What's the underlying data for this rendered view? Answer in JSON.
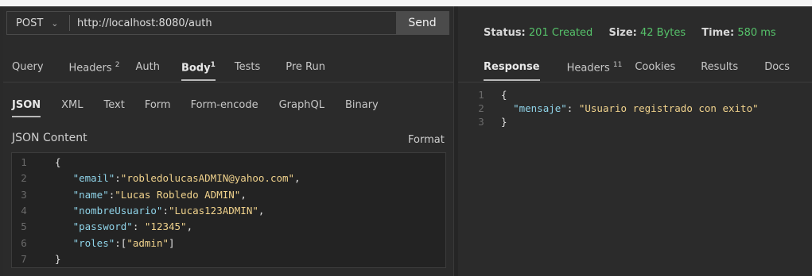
{
  "request": {
    "method": "POST",
    "url": "http://localhost:8080/auth",
    "send_label": "Send",
    "tabs": [
      {
        "label": "Query",
        "badge": ""
      },
      {
        "label": "Headers",
        "badge": "2"
      },
      {
        "label": "Auth",
        "badge": ""
      },
      {
        "label": "Body",
        "badge": "1"
      },
      {
        "label": "Tests",
        "badge": ""
      },
      {
        "label": "Pre Run",
        "badge": ""
      }
    ],
    "body_types": [
      "JSON",
      "XML",
      "Text",
      "Form",
      "Form-encode",
      "GraphQL",
      "Binary"
    ],
    "json_content_label": "JSON Content",
    "format_label": "Format",
    "lines": [
      {
        "n": "1",
        "indent": "",
        "tokens": [
          {
            "t": "p",
            "v": "{"
          }
        ]
      },
      {
        "n": "2",
        "indent": "   ",
        "tokens": [
          {
            "t": "k",
            "v": "\"email\""
          },
          {
            "t": "p",
            "v": ":"
          },
          {
            "t": "s",
            "v": "\"robledolucasADMIN@yahoo.com\""
          },
          {
            "t": "p",
            "v": ","
          }
        ]
      },
      {
        "n": "3",
        "indent": "   ",
        "tokens": [
          {
            "t": "k",
            "v": "\"name\""
          },
          {
            "t": "p",
            "v": ":"
          },
          {
            "t": "s",
            "v": "\"Lucas Robledo ADMIN\""
          },
          {
            "t": "p",
            "v": ","
          }
        ]
      },
      {
        "n": "4",
        "indent": "   ",
        "tokens": [
          {
            "t": "k",
            "v": "\"nombreUsuario\""
          },
          {
            "t": "p",
            "v": ":"
          },
          {
            "t": "s",
            "v": "\"Lucas123ADMIN\""
          },
          {
            "t": "p",
            "v": ","
          }
        ]
      },
      {
        "n": "5",
        "indent": "   ",
        "tokens": [
          {
            "t": "k",
            "v": "\"password\""
          },
          {
            "t": "p",
            "v": ": "
          },
          {
            "t": "s",
            "v": "\"12345\""
          },
          {
            "t": "p",
            "v": ","
          }
        ]
      },
      {
        "n": "6",
        "indent": "   ",
        "tokens": [
          {
            "t": "k",
            "v": "\"roles\""
          },
          {
            "t": "p",
            "v": ":["
          },
          {
            "t": "s",
            "v": "\"admin\""
          },
          {
            "t": "p",
            "v": "]"
          }
        ]
      },
      {
        "n": "7",
        "indent": "",
        "tokens": [
          {
            "t": "p",
            "v": "}"
          }
        ]
      }
    ]
  },
  "response": {
    "status_label": "Status:",
    "status_value": "201 Created",
    "size_label": "Size:",
    "size_value": "42 Bytes",
    "time_label": "Time:",
    "time_value": "580 ms",
    "tabs": [
      {
        "label": "Response",
        "badge": ""
      },
      {
        "label": "Headers",
        "badge": "11"
      },
      {
        "label": "Cookies",
        "badge": ""
      },
      {
        "label": "Results",
        "badge": ""
      },
      {
        "label": "Docs",
        "badge": ""
      }
    ],
    "lines": [
      {
        "n": "1",
        "indent": "",
        "tokens": [
          {
            "t": "p",
            "v": "{"
          }
        ]
      },
      {
        "n": "2",
        "indent": "  ",
        "tokens": [
          {
            "t": "k",
            "v": "\"mensaje\""
          },
          {
            "t": "p",
            "v": ": "
          },
          {
            "t": "s",
            "v": "\"Usuario registrado con exito\""
          }
        ]
      },
      {
        "n": "3",
        "indent": "",
        "tokens": [
          {
            "t": "p",
            "v": "}"
          }
        ]
      }
    ]
  },
  "colors": {
    "status_ok": "#56c26a",
    "json_key": "#8fd3e8",
    "json_string": "#f0d28c"
  },
  "icons": {
    "method_dropdown": "chevron-down-icon"
  }
}
